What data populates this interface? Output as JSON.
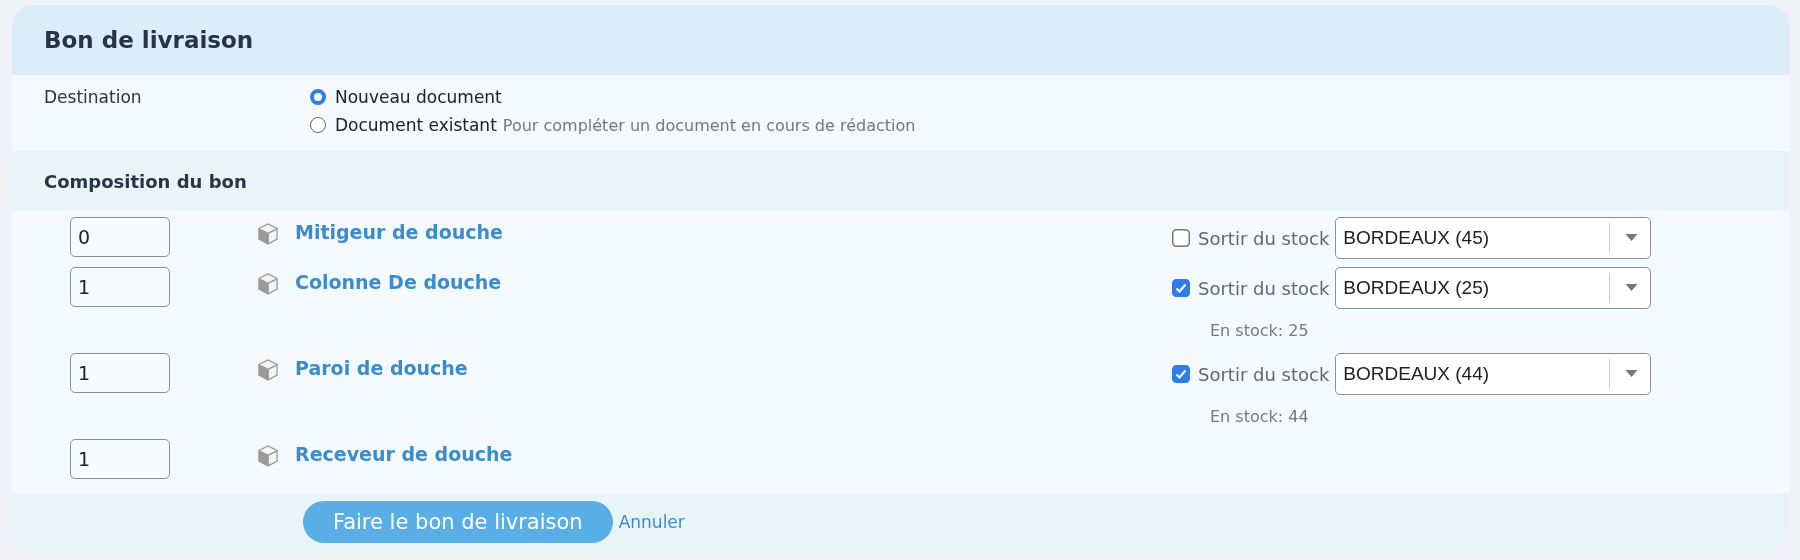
{
  "title": "Bon de livraison",
  "destination": {
    "label": "Destination",
    "options": [
      {
        "label": "Nouveau document",
        "selected": true
      },
      {
        "label": "Document existant",
        "hint": "Pour compléter un document en cours de rédaction",
        "selected": false
      }
    ]
  },
  "composition": {
    "title": "Composition du bon",
    "items": [
      {
        "quantity": "0",
        "name": "Mitigeur de douche",
        "stock": {
          "checked": false,
          "label": "Sortir du stock",
          "warehouse": "BORDEAUX (45)"
        }
      },
      {
        "quantity": "1",
        "name": "Colonne De douche",
        "stock": {
          "checked": true,
          "label": "Sortir du stock",
          "warehouse": "BORDEAUX (25)",
          "available": "En stock: 25"
        }
      },
      {
        "quantity": "1",
        "name": "Paroi de douche",
        "stock": {
          "checked": true,
          "label": "Sortir du stock",
          "warehouse": "BORDEAUX (44)",
          "available": "En stock: 44"
        }
      },
      {
        "quantity": "1",
        "name": "Receveur de douche"
      }
    ]
  },
  "actions": {
    "submit": "Faire le bon de livraison",
    "cancel": "Annuler"
  }
}
